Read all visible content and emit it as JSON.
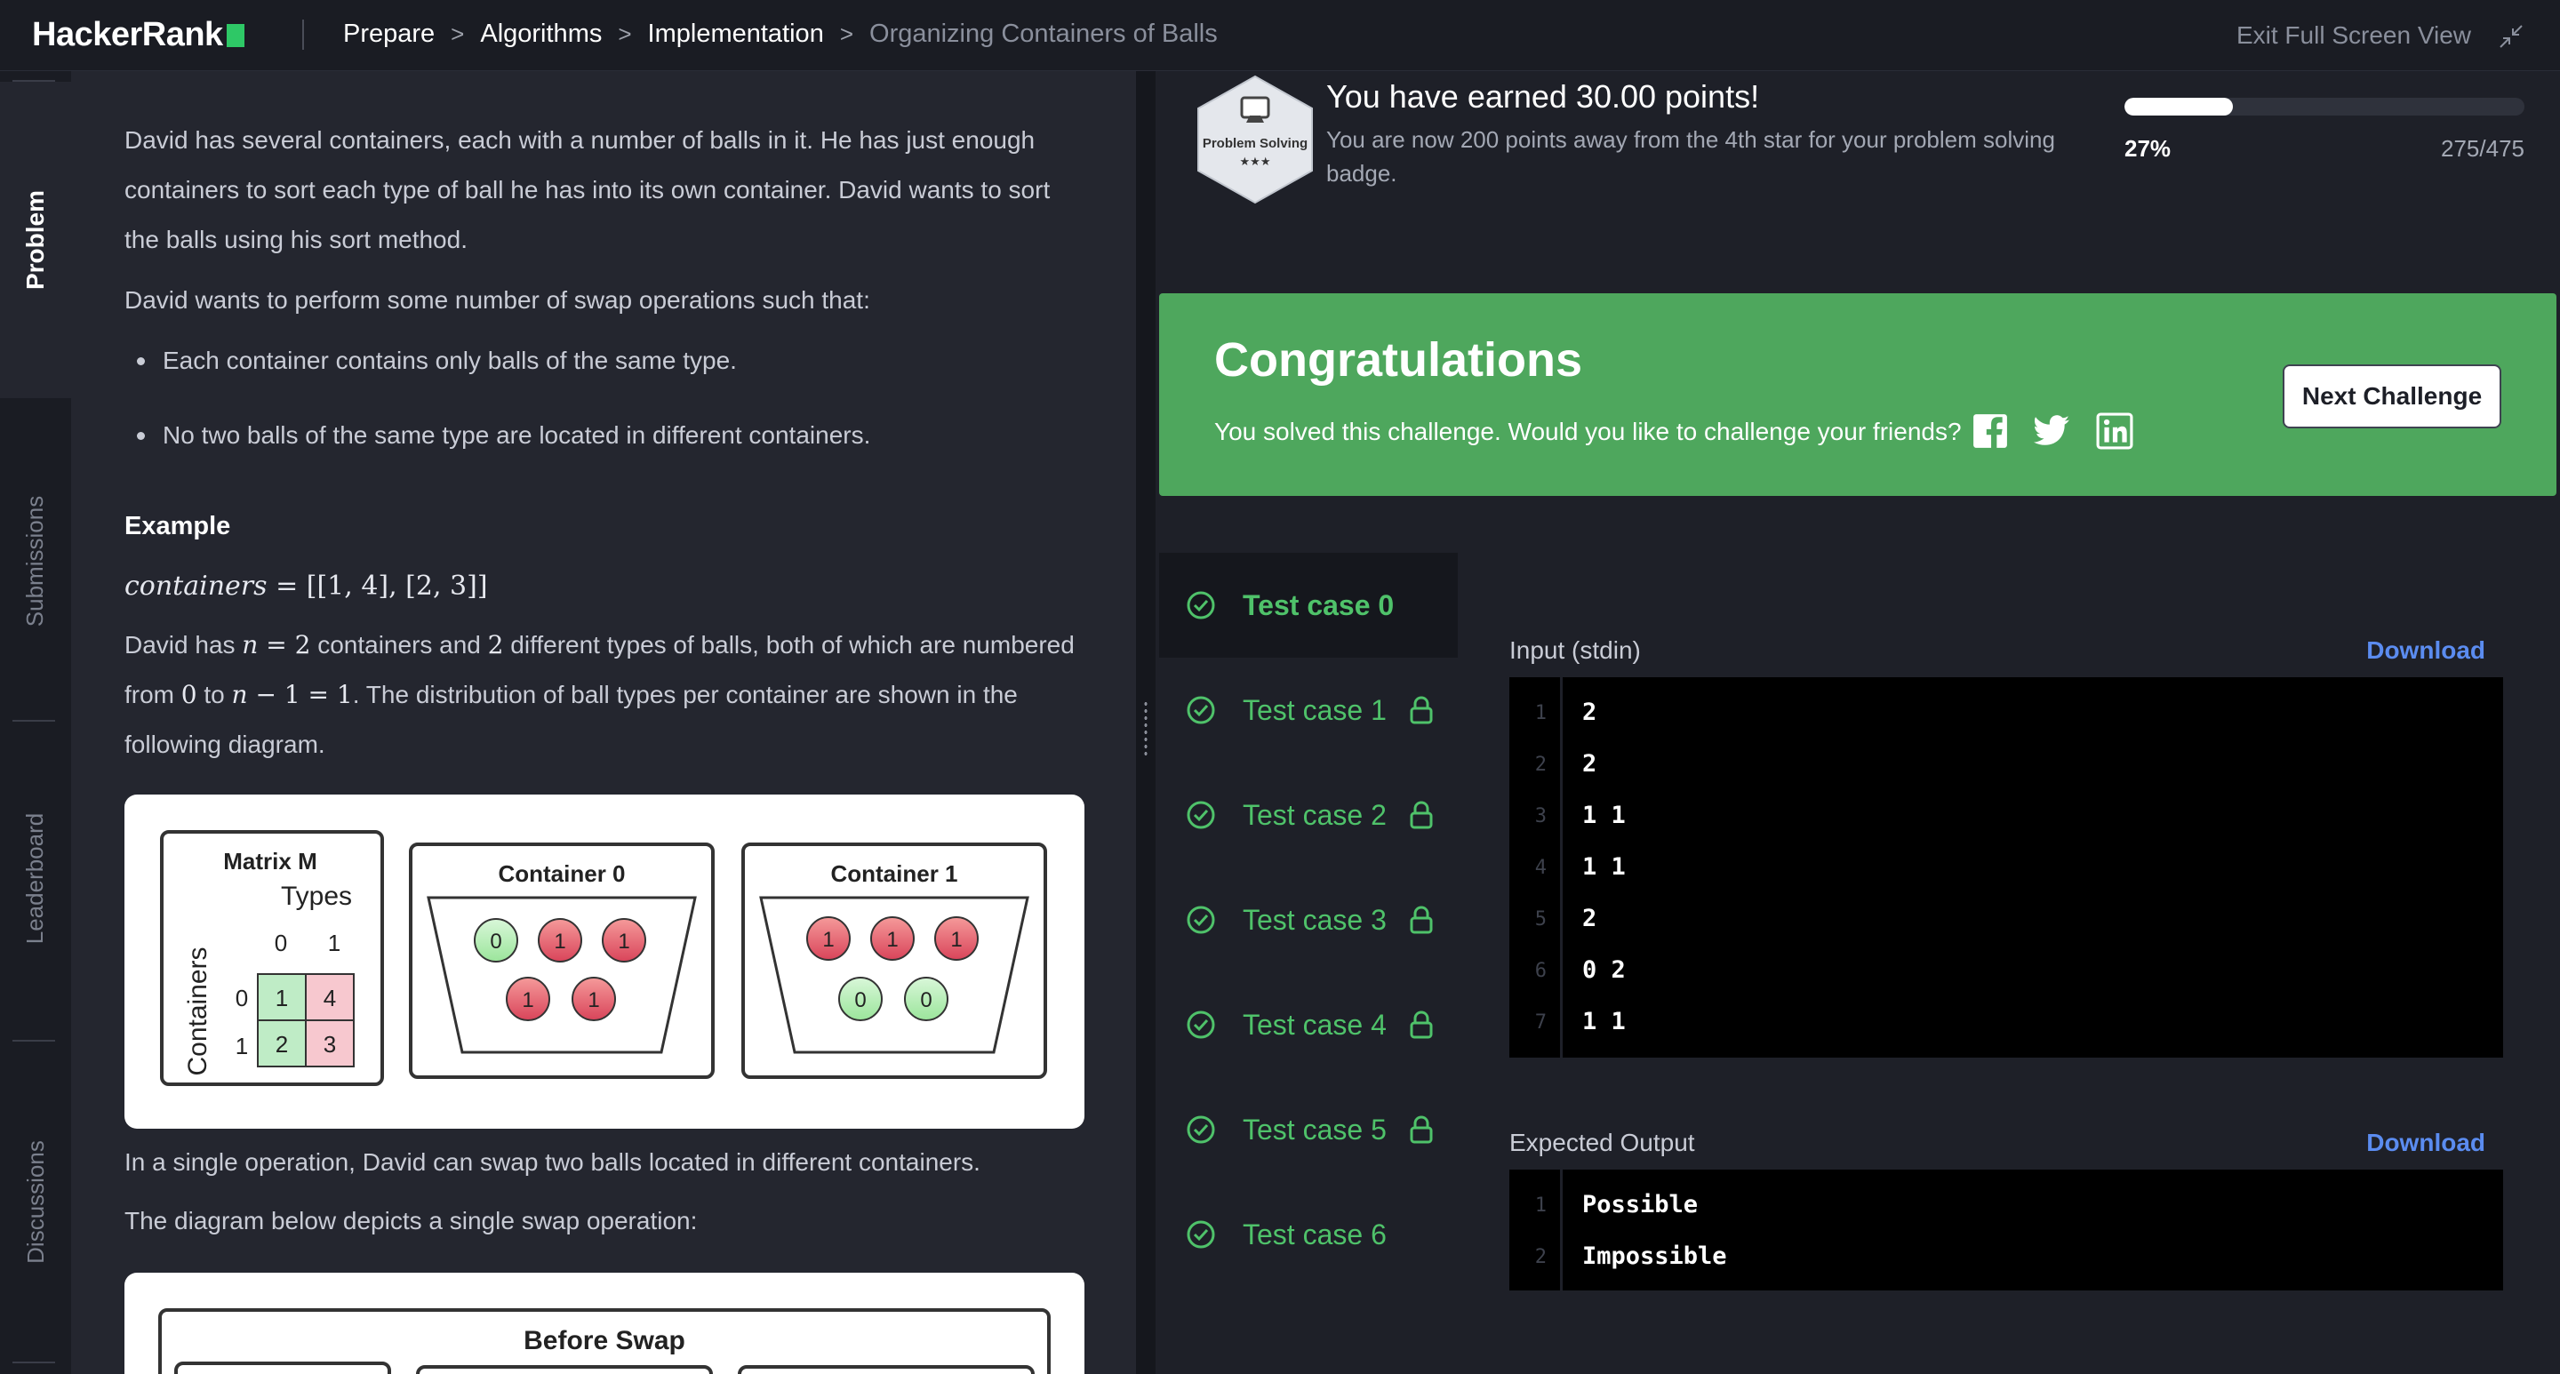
{
  "topbar": {
    "logo": "HackerRank",
    "breadcrumbs": [
      "Prepare",
      "Algorithms",
      "Implementation",
      "Organizing Containers of Balls"
    ],
    "exit_fullscreen": "Exit Full Screen View"
  },
  "sidetabs": [
    "Problem",
    "Submissions",
    "Leaderboard",
    "Discussions"
  ],
  "problem": {
    "para1_lines": [
      "David has several containers, each with a number of balls in it. He has just enough",
      "containers to sort each type of ball he has into its own container. David wants to sort",
      "the balls using his sort method."
    ],
    "para2": "David wants to perform some number of swap operations such that:",
    "bullets": [
      "Each container contains only balls of the same type.",
      "No two balls of the same type are located in different containers."
    ],
    "example_heading": "Example",
    "example_var": "containers",
    "example_eq": " = [[1, 4], [2, 3]]",
    "ex_line1": {
      "a": "David has ",
      "var": "n",
      "eq": " = 2",
      "b": " containers and ",
      "num": "2",
      "c": " different types of balls, both of which are numbered"
    },
    "ex_line2": {
      "a": "from ",
      "zero": "0",
      "b": " to ",
      "var": "n",
      "eq": " − 1 = 1",
      "c": ". The distribution of ball types per container are shown in the"
    },
    "ex_line3": "following diagram.",
    "after_fig1": "In a single operation, David can swap two balls located in different containers.",
    "after_fig2": "The diagram below depicts a single swap operation:",
    "diagram1": {
      "matrix_title": "Matrix M",
      "types_label": "Types",
      "containers_label": "Containers",
      "col_heads": [
        "0",
        "1"
      ],
      "row_heads": [
        "0",
        "1"
      ],
      "cells": [
        [
          "1",
          "4"
        ],
        [
          "2",
          "3"
        ]
      ],
      "container0_title": "Container 0",
      "container1_title": "Container 1",
      "container0_balls": [
        "0",
        "1",
        "1",
        "1",
        "1"
      ],
      "container1_balls": [
        "1",
        "1",
        "1",
        "0",
        "0"
      ]
    },
    "diagram2": {
      "title": "Before Swap"
    }
  },
  "result": {
    "earned": "You have earned 30.00 points!",
    "away": "You are now 200 points away from the 4th star for your problem solving badge.",
    "badge_label": "Problem Solving",
    "badge_stars": "★★★",
    "progress_fraction": 0.27,
    "progress_pct": "27%",
    "points": "275/475",
    "congrats_title": "Congratulations",
    "congrats_sub": "You solved this challenge. Would you like to challenge your friends?",
    "next_button": "Next Challenge"
  },
  "testcases": [
    {
      "label": "Test case 0",
      "locked": false,
      "active": true
    },
    {
      "label": "Test case 1",
      "locked": true,
      "active": false
    },
    {
      "label": "Test case 2",
      "locked": true,
      "active": false
    },
    {
      "label": "Test case 3",
      "locked": true,
      "active": false
    },
    {
      "label": "Test case 4",
      "locked": true,
      "active": false
    },
    {
      "label": "Test case 5",
      "locked": true,
      "active": false
    },
    {
      "label": "Test case 6",
      "locked": false,
      "active": false
    }
  ],
  "input": {
    "label": "Input (stdin)",
    "download": "Download",
    "lines": [
      "2",
      "2",
      "1 1",
      "1 1",
      "2",
      "0 2",
      "1 1"
    ],
    "line_numbers": [
      "1",
      "2",
      "3",
      "4",
      "5",
      "6",
      "7"
    ]
  },
  "output": {
    "label": "Expected Output",
    "download": "Download",
    "lines": [
      "Possible",
      "Impossible"
    ],
    "line_numbers": [
      "1",
      "2"
    ]
  },
  "colors": {
    "accent_green": "#4ea75d",
    "pass_green": "#4fc26a",
    "link_blue": "#5b8cf0"
  }
}
